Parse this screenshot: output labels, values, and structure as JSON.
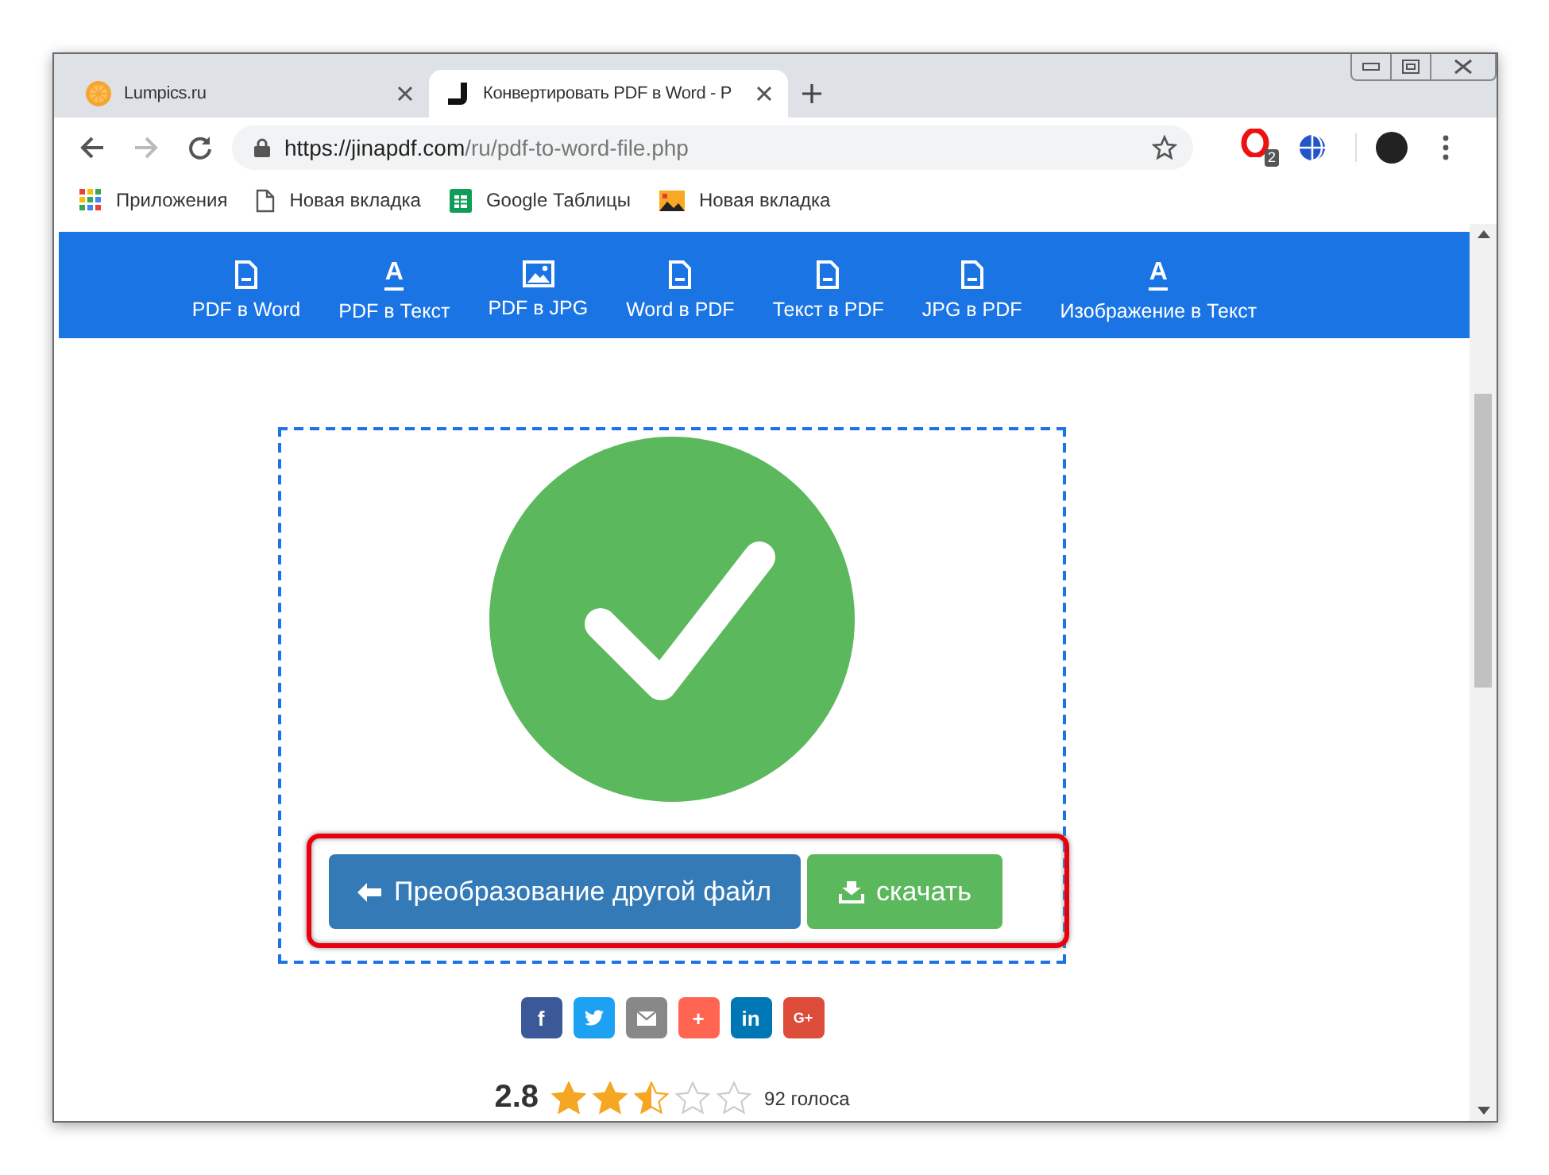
{
  "tabs": [
    {
      "title": "Lumpics.ru",
      "selected": false
    },
    {
      "title": "Конвертировать PDF в Word - P",
      "selected": true
    }
  ],
  "address_bar": {
    "url_host": "https://jinapdf.com",
    "url_path": "/ru/pdf-to-word-file.php"
  },
  "extension_badge": "2",
  "bookmarks": [
    {
      "label": "Приложения"
    },
    {
      "label": "Новая вкладка"
    },
    {
      "label": "Google Таблицы"
    },
    {
      "label": "Новая вкладка"
    }
  ],
  "nav": [
    {
      "label": "PDF в Word",
      "kind": "file"
    },
    {
      "label": "PDF в Текст",
      "kind": "letter",
      "glyph": "A"
    },
    {
      "label": "PDF в JPG",
      "kind": "image"
    },
    {
      "label": "Word в PDF",
      "kind": "file"
    },
    {
      "label": "Текст в PDF",
      "kind": "file"
    },
    {
      "label": "JPG в PDF",
      "kind": "file"
    },
    {
      "label": "Изображение в Текст",
      "kind": "letter",
      "glyph": "A"
    }
  ],
  "result": {
    "convert_another_button": "Преобразование другой файл",
    "download_button": "скачать",
    "highlighted": true
  },
  "share": [
    {
      "kind": "facebook",
      "label": "f",
      "color": "#3b5998"
    },
    {
      "kind": "twitter",
      "color": "#1da1f2"
    },
    {
      "kind": "email",
      "color": "#888888"
    },
    {
      "kind": "plus",
      "label": "+",
      "color": "#ff6550"
    },
    {
      "kind": "linkedin",
      "label": "in",
      "color": "#0077b5"
    },
    {
      "kind": "googleplus",
      "label": "G+",
      "color": "#dd4b39"
    }
  ],
  "rating": {
    "score": "2.8",
    "stars": 2.5,
    "votes": "92 голоса"
  }
}
